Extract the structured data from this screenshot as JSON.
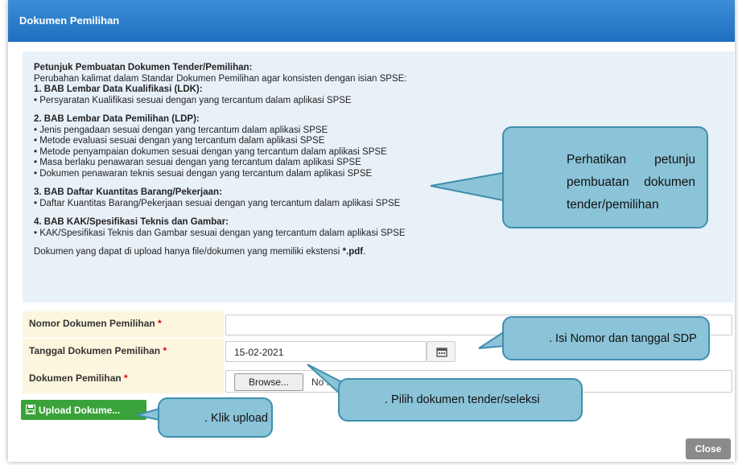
{
  "dialog": {
    "title": "Dokumen Pemilihan"
  },
  "instructions": {
    "heading": "Petunjuk Pembuatan Dokumen Tender/Pemilihan:",
    "intro": "Perubahan kalimat dalam Standar Dokumen Pemilihan agar konsisten dengan isian SPSE:",
    "sections": [
      {
        "title": "1. BAB Lembar Data Kualifikasi (LDK):",
        "items": [
          "• Persyaratan Kualifikasi sesuai dengan yang tercantum dalam aplikasi SPSE"
        ]
      },
      {
        "title": "2. BAB Lembar Data Pemilihan (LDP):",
        "items": [
          "• Jenis pengadaan sesuai dengan yang tercantum dalam aplikasi SPSE",
          "• Metode evaluasi sesuai dengan yang tercantum dalam aplikasi SPSE",
          "• Metode penyampaian dokumen sesuai dengan yang tercantum dalam aplikasi SPSE",
          "• Masa berlaku penawaran sesuai dengan yang tercantum dalam aplikasi SPSE",
          "• Dokumen penawaran teknis sesuai dengan yang tercantum dalam aplikasi SPSE"
        ]
      },
      {
        "title": "3. BAB Daftar Kuantitas Barang/Pekerjaan:",
        "items": [
          "• Daftar Kuantitas Barang/Pekerjaan sesuai dengan yang tercantum dalam aplikasi SPSE"
        ]
      },
      {
        "title": "4. BAB KAK/Spesifikasi Teknis dan Gambar:",
        "items": [
          "• KAK/Spesifikasi Teknis dan Gambar sesuai dengan yang tercantum dalam aplikasi SPSE"
        ]
      }
    ],
    "footer_prefix": "Dokumen yang dapat di upload hanya file/dokumen yang memiliki ekstensi ",
    "footer_ext": "*.pdf",
    "footer_suffix": "."
  },
  "form": {
    "nomor_label": "Nomor Dokumen Pemilihan",
    "tanggal_label": "Tanggal Dokumen Pemilihan",
    "tanggal_value": "15-02-2021",
    "dokumen_label": "Dokumen Pemilihan",
    "required_mark": " *",
    "browse_label": "Browse...",
    "file_status": "No fil"
  },
  "buttons": {
    "upload": "Upload Dokume...",
    "close": "Close"
  },
  "callouts": {
    "petunjuk_line1_a": "Perhatikan",
    "petunjuk_line1_b": "petunju",
    "petunjuk_line2_a": "pembuatan",
    "petunjuk_line2_b": "dokumen",
    "petunjuk_line3": "tender/pemilihan",
    "nomor": ". Isi Nomor dan tanggal SDP",
    "pilih": ". Pilih dokumen tender/seleksi",
    "upload": ". Klik upload"
  }
}
